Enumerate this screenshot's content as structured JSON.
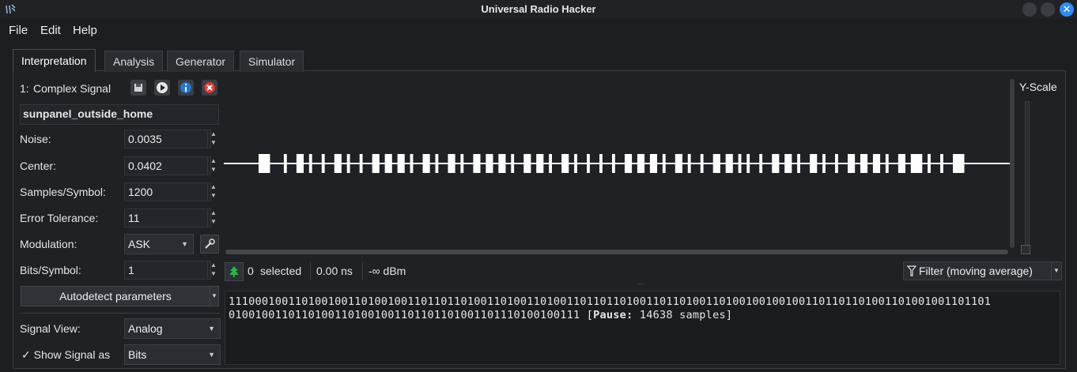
{
  "window": {
    "title": "Universal Radio Hacker"
  },
  "menubar": {
    "items": [
      "File",
      "Edit",
      "Help"
    ]
  },
  "tabs": [
    "Interpretation",
    "Analysis",
    "Generator",
    "Simulator"
  ],
  "signal": {
    "index_label": "1:",
    "type_label": "Complex Signal",
    "name": "sunpanel_outside_home",
    "noise_label": "Noise:",
    "noise_value": "0.0035",
    "center_label": "Center:",
    "center_value": "0.0402",
    "sps_label": "Samples/Symbol:",
    "sps_value": "1200",
    "tolerance_label": "Error Tolerance:",
    "tolerance_value": "11",
    "modulation_label": "Modulation:",
    "modulation_value": "ASK",
    "bps_label": "Bits/Symbol:",
    "bps_value": "1",
    "autodetect_label": "Autodetect parameters",
    "view_label": "Signal View:",
    "view_value": "Analog",
    "show_as_label": "✓ Show Signal as",
    "show_as_value": "Bits",
    "yscale_label": "Y-Scale"
  },
  "status": {
    "selected_count": "0",
    "selected_label": "selected",
    "duration": "0.00 ns",
    "power": "-∞ dBm",
    "filter_label": "Filter (moving average)"
  },
  "bits": {
    "line1": "1110001001101001001101001001101101101001101001101001101101101001101101001101001001001001101101101001101001001101101",
    "line2": "01001001101101001101001001101101101001101110100100111",
    "pause_open": " [",
    "pause_word": "Pause:",
    "pause_rest": " 14638 samples]"
  },
  "colors": {
    "accent": "#2f8cf0",
    "background": "#1c1e22",
    "signal": "#ffffff",
    "close": "#d23b3b"
  },
  "icons": [
    "urh-logo-icon",
    "save-icon",
    "play-icon",
    "info-icon",
    "close-red-icon",
    "wrench-icon",
    "tree-icon",
    "filter-icon"
  ]
}
